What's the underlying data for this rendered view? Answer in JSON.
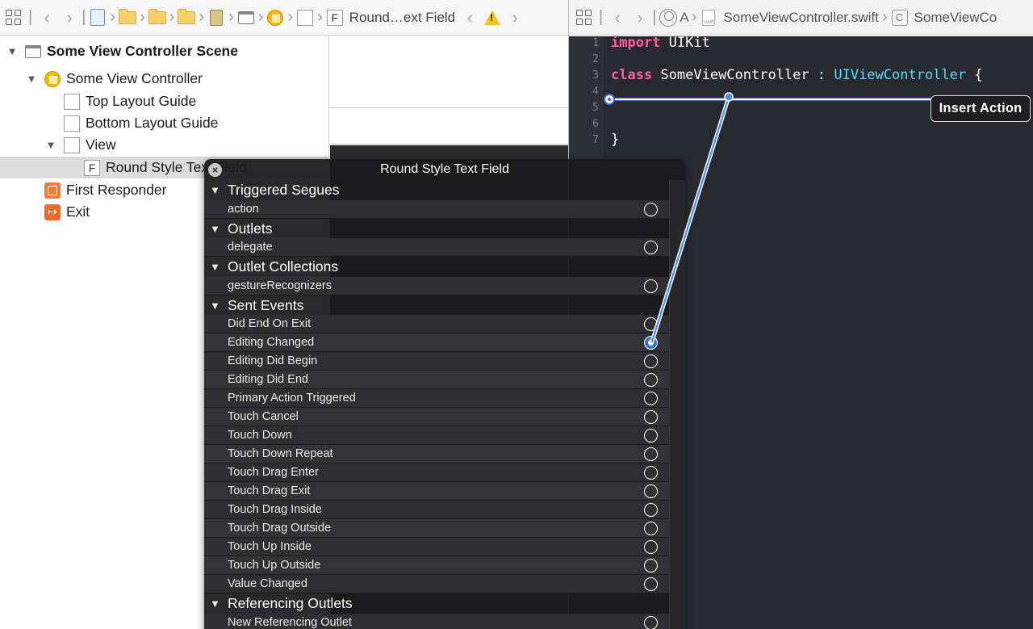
{
  "left_jumpbar": {
    "back_arrow": "‹",
    "forward_arrow": "›",
    "crumb_label": "Round…ext Field",
    "crumb_icon_letter": "F"
  },
  "right_jumpbar": {
    "back_arrow": "‹",
    "forward_arrow": "›",
    "automatic_label": "A",
    "file_label": "SomeViewController.swift",
    "class_label": "SomeViewCo",
    "class_icon_letter": "C"
  },
  "outline": {
    "items": [
      {
        "label": "Some View Controller Scene",
        "level": 0,
        "expanded": true,
        "icon": "scene-icon",
        "bold": true
      },
      {
        "label": "Some View Controller",
        "level": 1,
        "expanded": true,
        "icon": "view-controller-icon"
      },
      {
        "label": "Top Layout Guide",
        "level": 2,
        "icon": "layout-guide-icon"
      },
      {
        "label": "Bottom Layout Guide",
        "level": 2,
        "icon": "layout-guide-icon"
      },
      {
        "label": "View",
        "level": 2,
        "expanded": true,
        "icon": "view-icon"
      },
      {
        "label": "Round Style Text Field",
        "level": 3,
        "icon": "text-field-icon",
        "selected": true
      },
      {
        "label": "First Responder",
        "level": 1,
        "icon": "first-responder-icon"
      },
      {
        "label": "Exit",
        "level": 1,
        "icon": "exit-icon"
      }
    ]
  },
  "editor": {
    "line_numbers": [
      "1",
      "2",
      "3",
      "4",
      "5",
      "6",
      "7"
    ],
    "lines": [
      {
        "kw": "import",
        "text": " UIKit",
        "type": ""
      },
      {
        "kw": "",
        "text": "",
        "type": ""
      },
      {
        "kw": "class",
        "text": " SomeViewController : ",
        "type": "UIViewController",
        "tail": " {"
      },
      {
        "kw": "",
        "text": "",
        "type": ""
      },
      {
        "kw": "",
        "text": "",
        "type": ""
      },
      {
        "kw": "",
        "text": "",
        "type": ""
      },
      {
        "kw": "",
        "text": "}",
        "type": ""
      }
    ],
    "insert_tooltip": "Insert Action"
  },
  "connections_panel": {
    "title": "Round Style Text Field",
    "close_glyph": "×",
    "sections": [
      {
        "name": "Triggered Segues",
        "items": [
          "action"
        ]
      },
      {
        "name": "Outlets",
        "items": [
          "delegate"
        ]
      },
      {
        "name": "Outlet Collections",
        "items": [
          "gestureRecognizers"
        ]
      },
      {
        "name": "Sent Events",
        "items": [
          "Did End On Exit",
          "Editing Changed",
          "Editing Did Begin",
          "Editing Did End",
          "Primary Action Triggered",
          "Touch Cancel",
          "Touch Down",
          "Touch Down Repeat",
          "Touch Drag Enter",
          "Touch Drag Exit",
          "Touch Drag Inside",
          "Touch Drag Outside",
          "Touch Up Inside",
          "Touch Up Outside",
          "Value Changed"
        ]
      },
      {
        "name": "Referencing Outlets",
        "items": [
          "New Referencing Outlet"
        ]
      }
    ],
    "active_connection": "Editing Changed"
  },
  "colors": {
    "accent": "#3a6fd8",
    "keyword": "#fc5fa3",
    "type": "#5dd8ff",
    "editor_bg": "#292a30"
  }
}
